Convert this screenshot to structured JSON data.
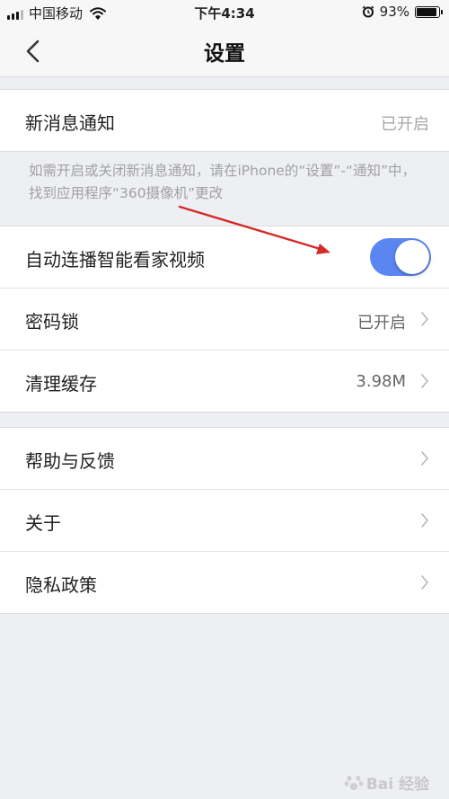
{
  "status_bar": {
    "carrier": "中国移动",
    "time": "下午4:34",
    "battery": "93%",
    "battery_level": 0.93
  },
  "nav": {
    "title": "设置"
  },
  "notifications": {
    "label": "新消息通知",
    "value": "已开启",
    "hint": "如需开启或关闭新消息通知，请在iPhone的“设置”-“通知”中，找到应用程序“360摄像机”更改"
  },
  "settings": [
    {
      "label": "自动连播智能看家视频",
      "toggle": true
    },
    {
      "label": "密码锁",
      "value": "已开启"
    },
    {
      "label": "清理缓存",
      "value": "3.98M"
    }
  ],
  "more": [
    {
      "label": "帮助与反馈"
    },
    {
      "label": "关于"
    },
    {
      "label": "隐私政策"
    }
  ],
  "colors": {
    "toggle_on": "#5b86f1",
    "annotation_arrow": "#d42a2a"
  },
  "watermark": {
    "text": "Bai 经验"
  }
}
